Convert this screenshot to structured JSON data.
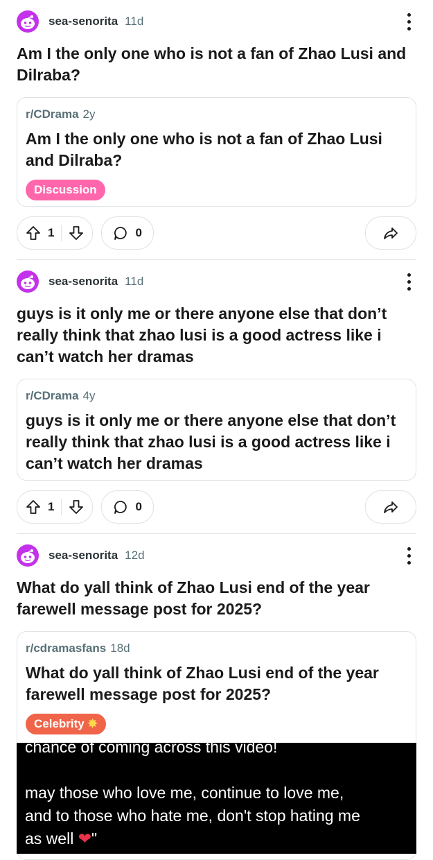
{
  "posts": [
    {
      "username": "sea-senorita",
      "age": "11d",
      "title": "Am I the only one who is not a fan of Zhao Lusi and Dilraba?",
      "crosspost": {
        "subreddit": "r/CDrama",
        "age": "2y",
        "title": "Am I the only one who is not a fan of Zhao Lusi and Dilraba?",
        "flair": "Discussion"
      },
      "votes": "1",
      "comments": "0"
    },
    {
      "username": "sea-senorita",
      "age": "11d",
      "title": "guys is it only me or there anyone else that don’t really think that zhao lusi is a good actress like i can’t watch her dramas",
      "crosspost": {
        "subreddit": "r/CDrama",
        "age": "4y",
        "title": "guys is it only me or there anyone else that don’t really think that zhao lusi is a good actress like i can’t watch her dramas"
      },
      "votes": "1",
      "comments": "0"
    },
    {
      "username": "sea-senorita",
      "age": "12d",
      "title": "What do yall think of Zhao Lusi end of the year farewell message post for 2025?",
      "crosspost": {
        "subreddit": "r/cdramasfans",
        "age": "18d",
        "title": "What do yall think of Zhao Lusi end of the year farewell message post for 2025?",
        "flair": "Celebrity",
        "video_text": {
          "line1": "chance of coming across this video!",
          "line2": "may those who love me, continue to love me,",
          "line3": "and to those who hate me, don't stop hating me",
          "line4_start": "as well",
          "line4_end": "\""
        }
      }
    }
  ],
  "colors": {
    "avatar": "#c332ea",
    "flair_discussion": "#ff66ac",
    "flair_celebrity": "#f06449",
    "meta_text": "#576f76",
    "border": "#dfe3e6"
  }
}
